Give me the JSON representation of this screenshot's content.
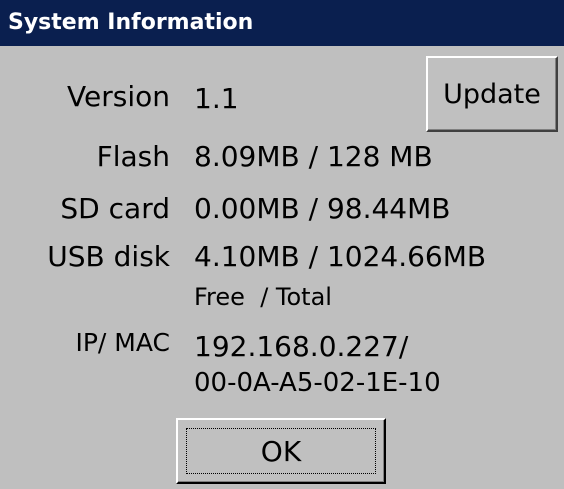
{
  "window": {
    "title": "System Information"
  },
  "rows": {
    "version": {
      "label": "Version",
      "value": "1.1"
    },
    "flash": {
      "label": "Flash",
      "value": "8.09MB / 128 MB"
    },
    "sd_card": {
      "label": "SD card",
      "value": "0.00MB / 98.44MB"
    },
    "usb_disk": {
      "label": "USB disk",
      "value": "4.10MB / 1024.66MB"
    },
    "free_total_caption": "Free  / Total",
    "ip_mac": {
      "label": "IP/ MAC",
      "ip": "192.168.0.227/",
      "mac": "00-0A-A5-02-1E-10"
    }
  },
  "buttons": {
    "update_label": "Update",
    "ok_label": "OK"
  },
  "colors": {
    "titlebar": "#0a1f4f",
    "background": "#bfbfbf",
    "button_face": "#c0c0c0"
  }
}
